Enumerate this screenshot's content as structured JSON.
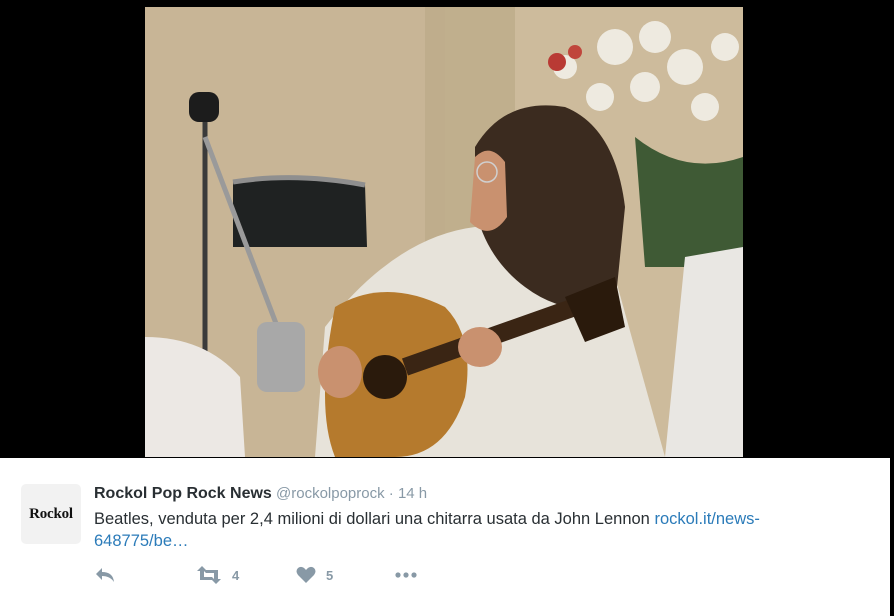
{
  "photo": {
    "icon": "photo-lennon-guitar"
  },
  "tweet": {
    "avatar_text": "Rockol",
    "author_name": "Rockol Pop Rock News",
    "author_handle": "@rockolpoprock",
    "separator": "·",
    "time": "14 h",
    "text_prefix": "Beatles, venduta per 2,4 milioni di dollari una chitarra usata da John Lennon ",
    "link_text": "rockol.it/news-648775/be…",
    "link_color": "#2b7bb9"
  },
  "actions": {
    "reply_icon": "reply-icon",
    "retweet_icon": "retweet-icon",
    "retweet_count": "4",
    "like_icon": "heart-icon",
    "like_count": "5",
    "more_icon": "more-icon"
  }
}
